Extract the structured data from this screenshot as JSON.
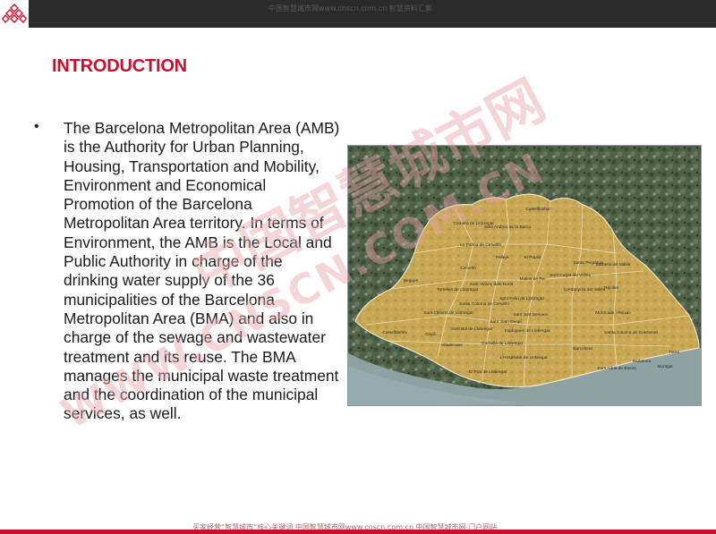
{
  "header": {
    "watermark": "中国智慧城市网www.cnscn.com.cn 智慧资料汇集"
  },
  "slide": {
    "title": "INTRODUCTION",
    "bullet_symbol": "•",
    "body": "The Barcelona Metropolitan Area (AMB) is the Authority for Urban Planning, Housing, Transportation and Mobility, Environment and Economical Promotion of the Barcelona Metropolitan Area territory. In terms of Environment, the AMB is the Local and Public Authority in charge of the drinking water supply of the 36 municipalities of the Barcelona Metropolitan Area (BMA) and also in charge of the sewage and wastewater treatment and its reuse. The BMA manages the municipal waste treatment and the coordination of the municipal services, as well."
  },
  "map": {
    "labels": {
      "castellbisbal": "Castellbisbal",
      "corbera": "Corbera de Llobregat",
      "sant_andreu": "Sant Andreu de la Barca",
      "la_palma": "La Palma de Cervelló",
      "pallejà": "Pallejà",
      "el_papiol": "El Papiol",
      "cervello": "Cervelló",
      "santa_perpetua": "Santa Perpètua",
      "barbera": "Barberà del Vallès",
      "sant_cugat": "Sant Cugat del Vallès",
      "begues": "Begues",
      "torrelles": "Torrelles de Llobregat",
      "sant_vicenc": "Sant Vicenç dels Horts",
      "molins": "Molins de Rei",
      "cerdanyola": "Cerdanyola del Vallès",
      "ripollet": "Ripollet",
      "santa_coloma_cervello": "Santa Coloma de Cervelló",
      "sant_feliu": "Sant Feliu de Llobregat",
      "sant_climent": "Sant Climent de Llobregat",
      "sant_joan": "Sant Joan Despí",
      "sant_just": "Sant Just Desvern",
      "montcada": "Montcada i Reixac",
      "castelldefels": "Castelldefels",
      "gava": "Gavà",
      "sant_boi": "Sant Boi de Llobregat",
      "esplugues": "Esplugues de Llobregat",
      "viladecans": "Viladecans",
      "cornella": "Cornellà de Llobregat",
      "barcelona": "Barcelona",
      "santa_coloma_gramenet": "Santa Coloma de Gramenet",
      "lhospitalet": "L'Hospitalet de Llobregat",
      "badalona": "Badalona",
      "tiana": "Tiana",
      "el_prat": "El Prat de Llobregat",
      "sant_adria": "Sant Adrià de Besòs",
      "montgat": "Montgat"
    }
  },
  "overlay": {
    "watermark_cn": "中国智慧城市网",
    "watermark_url": "WWW.CNSCN.COM.CN"
  },
  "footer": {
    "watermark": "买家经营“智慧城市”核心关键词 中国智慧城市网www.cnscn.com.cn 中国智慧城市网·门户网站"
  },
  "colors": {
    "accent": "#c8102e",
    "topbar": "#2b2b2b",
    "map_region": "#d2ad55",
    "sea": "#8ea2a2"
  }
}
